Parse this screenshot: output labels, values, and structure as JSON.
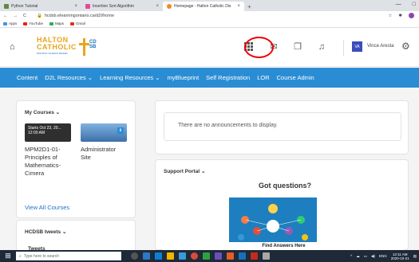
{
  "browser": {
    "tabs": [
      {
        "label": "Python Tutorial",
        "color": "#5b8c3a"
      },
      {
        "label": "Insertion Sort Algorithm",
        "color": "#e34a9a"
      },
      {
        "label": "Homepage - Halton Catholic Dis",
        "color": "#f08a24"
      }
    ],
    "new_tab": "+",
    "url": "hcdsb.elearningontario.ca/d2l/home",
    "bookmarks": [
      {
        "label": "Apps",
        "color": "#4a90d9"
      },
      {
        "label": "YouTube",
        "color": "#e62117"
      },
      {
        "label": "Maps",
        "color": "#34a853"
      },
      {
        "label": "Gmail",
        "color": "#d93025"
      }
    ],
    "window_controls": [
      "—",
      "□"
    ]
  },
  "header": {
    "logo_line1": "HALTON",
    "logo_line2": "CATHOLIC",
    "logo_tag": "DISTRICT SCHOOL BOARD",
    "logo_cdsb": "CD SB",
    "user_initials": "VA",
    "user_name": "Vince Aresta"
  },
  "nav": {
    "items": [
      "Content",
      "D2L Resources ⌄",
      "Learning Resources ⌄",
      "myBlueprint",
      "Self Registration",
      "LOR",
      "Course Admin"
    ]
  },
  "my_courses": {
    "title": "My Courses ⌄",
    "tile1_text": "Starts Oct 23, 20... 12:00 AM",
    "course1": [
      "MPM2D1-01-",
      "Principles of",
      "Mathematics-",
      "Cimera"
    ],
    "course2": [
      "Administrator",
      "Site"
    ],
    "view_all": "View All Courses"
  },
  "tweets": {
    "title": "HCDSB tweets ⌄",
    "sub": "Tweets"
  },
  "announcements": {
    "text": "There are no announcements to display."
  },
  "support": {
    "title": "Support Portal ⌄",
    "heading": "Got questions?",
    "find": "Find Answers Here"
  },
  "taskbar": {
    "search_placeholder": "Type here to search",
    "tray_lang": "ENG",
    "time": "12:11 AM",
    "date": "2020-10-21",
    "icon_colors": [
      "#555",
      "#2b78c5",
      "#0f7fd4",
      "#f5b400",
      "#3a9ad9",
      "#d94b3a",
      "#2ea043",
      "#6b4fbb",
      "#e35d27",
      "#1b6fb8",
      "#c42b1c",
      "#a7a7a7"
    ]
  }
}
